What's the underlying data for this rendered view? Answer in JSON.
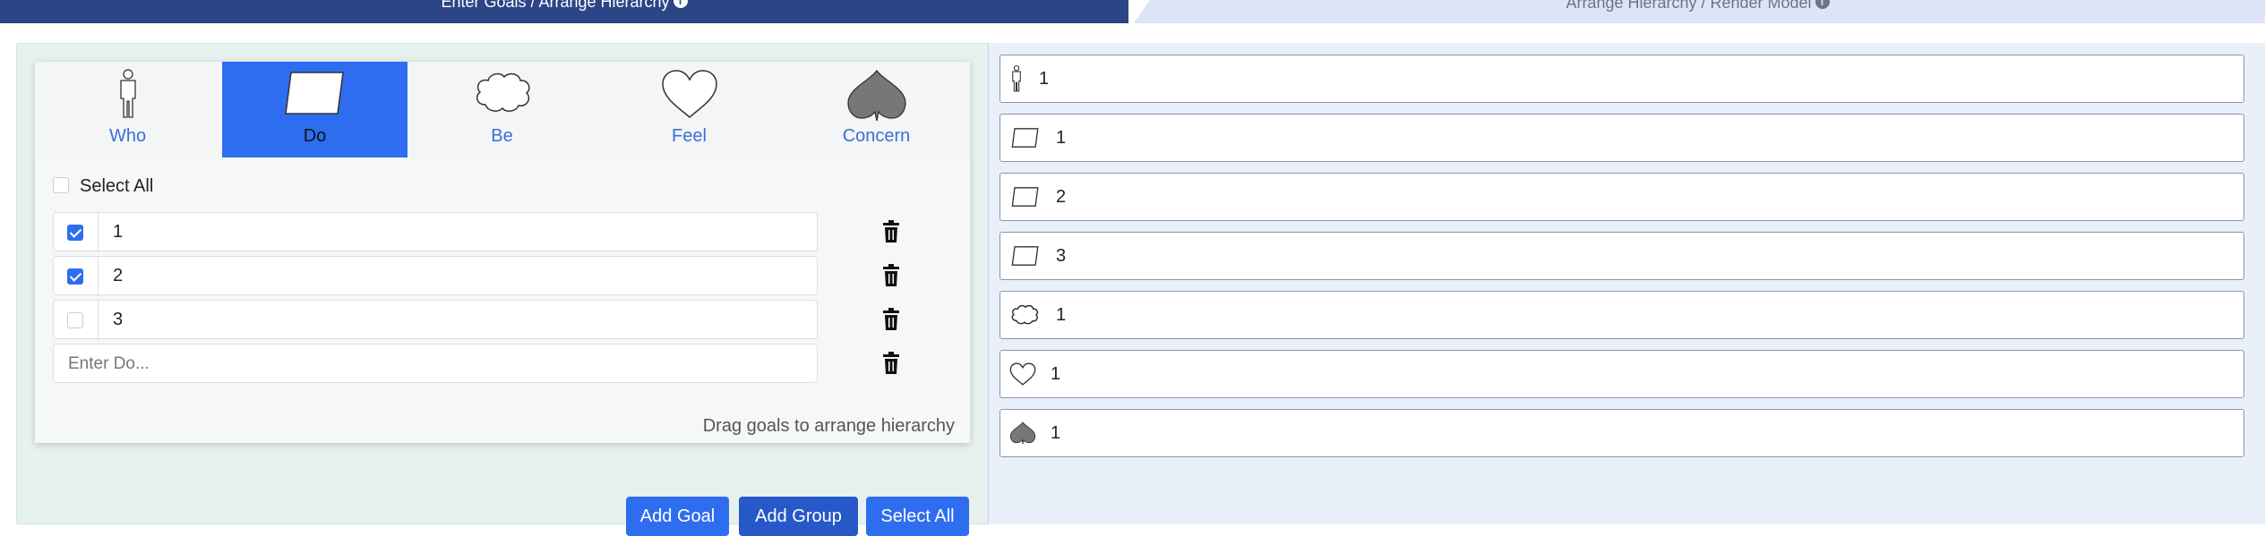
{
  "tabs": {
    "left_label": "Enter Goals / Arrange Hierarchy",
    "right_label": "Arrange Hierarchy / Render Model",
    "info_glyph": "i"
  },
  "categories": [
    {
      "label": "Who",
      "icon": "person-icon",
      "active": false
    },
    {
      "label": "Do",
      "icon": "parallelogram-icon",
      "active": true
    },
    {
      "label": "Be",
      "icon": "cloud-icon",
      "active": false
    },
    {
      "label": "Feel",
      "icon": "heart-icon",
      "active": false
    },
    {
      "label": "Concern",
      "icon": "spade-icon",
      "active": false
    }
  ],
  "goal_list": {
    "select_all_label": "Select All",
    "select_all_checked": false,
    "items": [
      {
        "value": "1",
        "checked": true
      },
      {
        "value": "2",
        "checked": true
      },
      {
        "value": "3",
        "checked": false
      }
    ],
    "new_placeholder": "Enter Do...",
    "hint": "Drag goals to arrange hierarchy"
  },
  "buttons": {
    "add_goal": "Add Goal",
    "add_group": "Add Group",
    "select_all": "Select All"
  },
  "hierarchy": [
    {
      "icon": "person-icon",
      "label": "1"
    },
    {
      "icon": "parallelogram-icon",
      "label": "1"
    },
    {
      "icon": "parallelogram-icon",
      "label": "2"
    },
    {
      "icon": "parallelogram-icon",
      "label": "3"
    },
    {
      "icon": "cloud-icon",
      "label": "1"
    },
    {
      "icon": "heart-icon",
      "label": "1"
    },
    {
      "icon": "spade-icon",
      "label": "1"
    }
  ],
  "colors": {
    "primary": "#2f6df0",
    "header_dark": "#2b4586",
    "concern_gray": "#777777"
  }
}
